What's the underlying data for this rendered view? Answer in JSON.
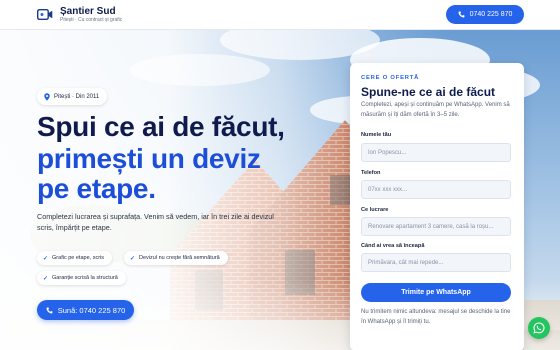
{
  "header": {
    "brand_name": "Șantier Sud",
    "brand_sub": "Pitești · Cu contract și grafic",
    "call_label": "0740 225 870"
  },
  "hero": {
    "location": "Pitești · Din 2011",
    "title_line1": "Spui ce ai de făcut,",
    "title_line2": "primești un deviz",
    "title_line3": "pe etape.",
    "lead": "Completezi lucrarea și suprafața. Venim să vedem, iar în trei zile ai devizul scris, împărțit pe etape.",
    "chips": [
      "Grafic pe etape, scris",
      "Devizul nu crește fără semnătură",
      "Garanție scrisă la structură"
    ],
    "call_button": "Sună: 0740 225 870"
  },
  "form": {
    "eyebrow": "CERE O OFERTĂ",
    "title": "Spune-ne ce ai de făcut",
    "description": "Completezi, apeși și continuăm pe WhatsApp. Venim să măsurăm și îți dăm ofertă în 3–5 zile.",
    "fields": [
      {
        "label": "Numele tău",
        "placeholder": "Ion Popescu..."
      },
      {
        "label": "Telefon",
        "placeholder": "07xx xxx xxx..."
      },
      {
        "label": "Ce lucrare",
        "placeholder": "Renovare apartament 3 camere, casă la roșu..."
      },
      {
        "label": "Când ai vrea să înceapă",
        "placeholder": "Primăvara, cât mai repede..."
      }
    ],
    "submit": "Trimite pe WhatsApp",
    "note": "Nu trimitem nimic altundeva: mesajul se deschide la tine în WhatsApp și îl trimiți tu."
  },
  "icons": {
    "logo": "camera-icon",
    "phone": "phone-icon",
    "pin": "map-pin-icon",
    "check": "check-icon",
    "whatsapp": "whatsapp-icon"
  },
  "colors": {
    "primary": "#2563eb",
    "heading": "#0f1b4c",
    "whatsapp": "#22c55e"
  }
}
